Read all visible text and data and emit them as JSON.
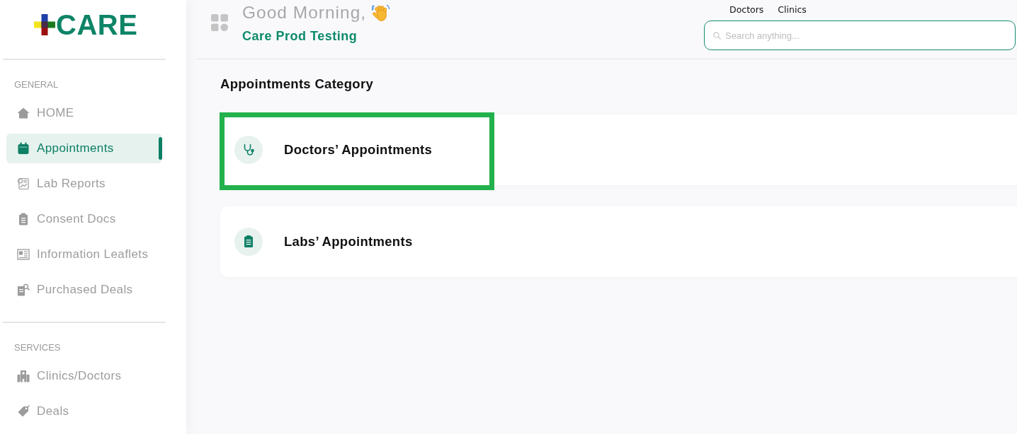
{
  "sidebar": {
    "logo": "CARE",
    "sections": [
      {
        "heading": "GENERAL",
        "items": [
          {
            "label": "HOME",
            "kind": "home",
            "selected": false
          },
          {
            "label": "Appointments",
            "kind": "appointments",
            "selected": true
          },
          {
            "label": "Lab Reports",
            "kind": "lab-reports",
            "selected": false
          },
          {
            "label": "Consent Docs",
            "kind": "consent-docs",
            "selected": false
          },
          {
            "label": "Information Leaflets",
            "kind": "leaflets",
            "selected": false
          },
          {
            "label": "Purchased Deals",
            "kind": "purchased-deals",
            "selected": false
          }
        ]
      },
      {
        "heading": "SERVICES",
        "items": [
          {
            "label": "Clinics/Doctors",
            "kind": "clinics",
            "selected": false
          },
          {
            "label": "Deals",
            "kind": "deals",
            "selected": false
          }
        ]
      }
    ]
  },
  "header": {
    "greeting": "Good Morning,",
    "user_name": "Care Prod Testing",
    "links": [
      "Doctors",
      "Clinics"
    ],
    "search": {
      "placeholder": "Search anything..."
    }
  },
  "main": {
    "title": "Appointments Category",
    "categories": [
      {
        "label": "Doctors’ Appointments",
        "kind": "doctors",
        "highlighted": true
      },
      {
        "label": "Labs’ Appointments",
        "kind": "labs",
        "highlighted": false
      }
    ]
  }
}
